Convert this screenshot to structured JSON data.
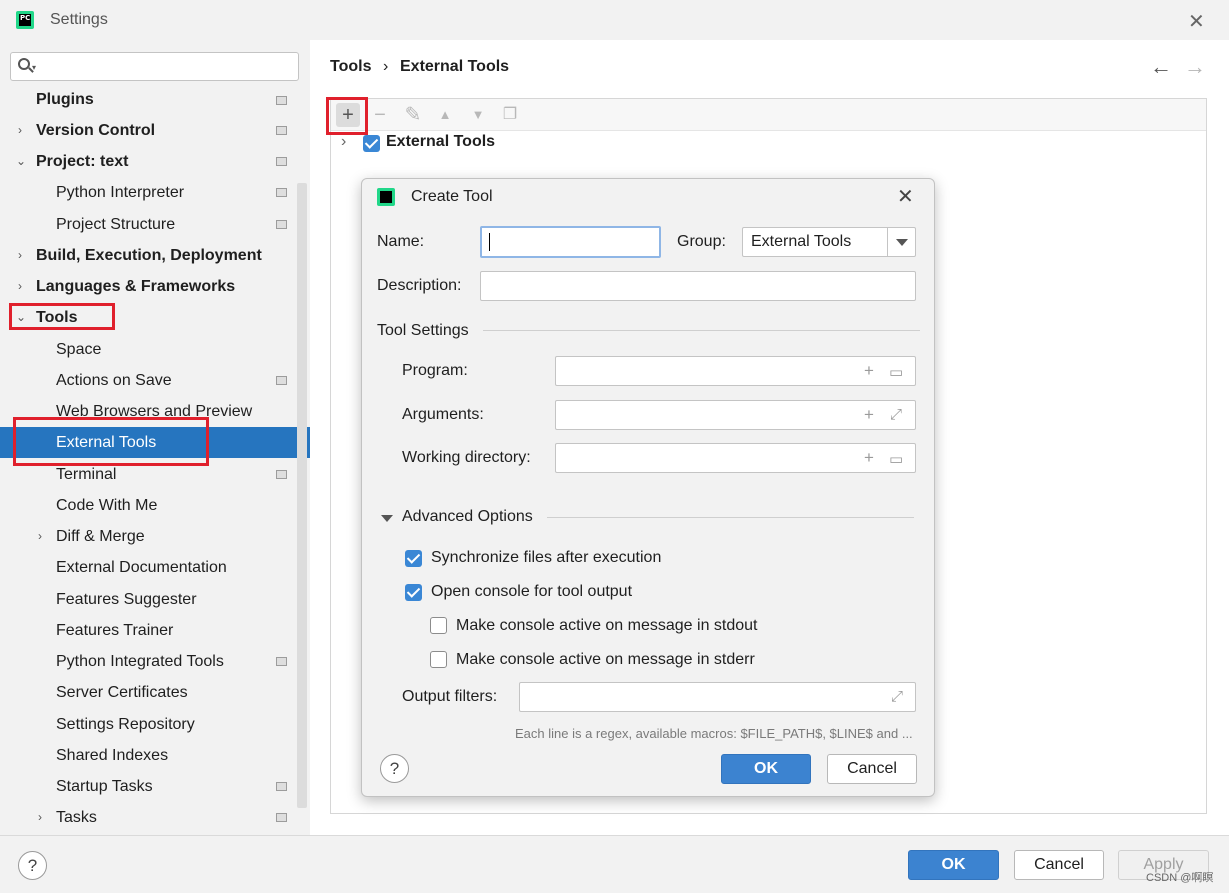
{
  "window": {
    "title": "Settings",
    "app_icon": "PC"
  },
  "search": {
    "placeholder": ""
  },
  "sidebar": {
    "items": [
      {
        "label": "Plugins"
      },
      {
        "label": "Version Control"
      },
      {
        "label": "Project: text"
      },
      {
        "label": "Python Interpreter"
      },
      {
        "label": "Project Structure"
      },
      {
        "label": "Build, Execution, Deployment"
      },
      {
        "label": "Languages & Frameworks"
      },
      {
        "label": "Tools"
      },
      {
        "label": "Space"
      },
      {
        "label": "Actions on Save"
      },
      {
        "label": "Web Browsers and Preview"
      },
      {
        "label": "External Tools"
      },
      {
        "label": "Terminal"
      },
      {
        "label": "Code With Me"
      },
      {
        "label": "Diff & Merge"
      },
      {
        "label": "External Documentation"
      },
      {
        "label": "Features Suggester"
      },
      {
        "label": "Features Trainer"
      },
      {
        "label": "Python Integrated Tools"
      },
      {
        "label": "Server Certificates"
      },
      {
        "label": "Settings Repository"
      },
      {
        "label": "Shared Indexes"
      },
      {
        "label": "Startup Tasks"
      },
      {
        "label": "Tasks"
      }
    ]
  },
  "breadcrumb": {
    "parent": "Tools",
    "separator": "›",
    "current": "External Tools"
  },
  "tools_tree": {
    "group_label": "External Tools",
    "group_checked": true
  },
  "dialog": {
    "title": "Create Tool",
    "name_label": "Name:",
    "name_value": "",
    "group_label": "Group:",
    "group_value": "External Tools",
    "description_label": "Description:",
    "tool_settings_heading": "Tool Settings",
    "program_label": "Program:",
    "arguments_label": "Arguments:",
    "working_dir_label": "Working directory:",
    "advanced_heading": "Advanced Options",
    "opt_sync": "Synchronize files after execution",
    "opt_console": "Open console for tool output",
    "opt_stdout": "Make console active on message in stdout",
    "opt_stderr": "Make console active on message in stderr",
    "output_filters_label": "Output filters:",
    "hint": "Each line is a regex, available macros: $FILE_PATH$, $LINE$ and ...",
    "help": "?",
    "ok": "OK",
    "cancel": "Cancel"
  },
  "footer": {
    "help": "?",
    "ok": "OK",
    "cancel": "Cancel",
    "apply": "Apply"
  },
  "watermark": "CSDN @啊瞑",
  "colors": {
    "selection": "#2675bf",
    "primary_button": "#3c83d0",
    "highlight_box": "#e0202c"
  }
}
